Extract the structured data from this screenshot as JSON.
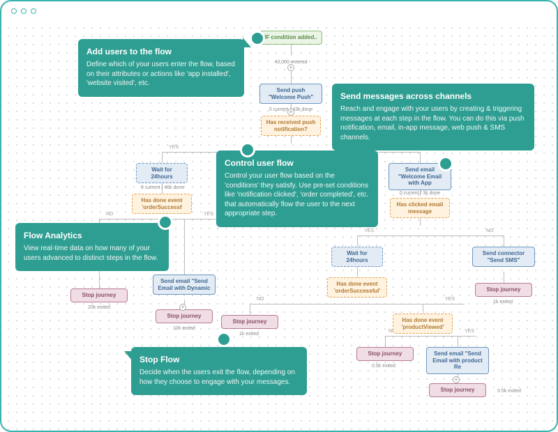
{
  "labels": {
    "yes": "YES",
    "no": "NO"
  },
  "nodes": {
    "ifCondition": "IF condition added..",
    "entered": "43,000 entered",
    "sendPush": "Send push \"Welcome Push\"",
    "pushStats": "0 current / 43k done",
    "hasReceivedPush": "Has received push notification?",
    "wait24": "Wait for 24hours",
    "waitStatsLeft": "0 current / 40k done",
    "orderSuccessShort": "Has done event 'orderSuccessf",
    "orderSuccessFull": "Has done event 'orderSuccessful'",
    "sendEmailDynamic": "Send email \"Send Email with Dynamic",
    "sendEmailWelcome": "Send email \"Welcome Email with App",
    "emailStats": "0 current / 3k done",
    "hasClickedEmail": "Has clicked email message",
    "sendSms": "Send connector \"Send SMS\"",
    "productViewed": "Has done event 'productViewed'",
    "sendEmailProduct": "Send email \"Send Email with product Re",
    "stop": "Stop journey",
    "exit20k": "20k exited",
    "exit10k": "10k exited",
    "exit1k": "1k exited",
    "exit05k": "0.5k exited"
  },
  "callouts": {
    "addUsers": {
      "title": "Add users to the flow",
      "body": "Define which of your users enter the flow, based on their attributes or actions like 'app installed', 'website visited', etc."
    },
    "sendMessages": {
      "title": "Send messages across channels",
      "body": "Reach and engage with your users by creating & triggering messages at each step in the flow. You can do this via push notification, email, in-app message, web push & SMS channels."
    },
    "controlFlow": {
      "title": "Control user flow",
      "body": "Control your user flow based on the 'conditions' they satisfy. Use pre-set conditions like 'notification clicked', 'order completed', etc. that automatically flow the user to the next appropriate step."
    },
    "analytics": {
      "title": "Flow Analytics",
      "body": "View real-time data on how many of your users advanced to distinct steps in the flow."
    },
    "stopFlow": {
      "title": "Stop Flow",
      "body": "Decide when the users exit the flow, depending on how they choose to engage with your messages."
    }
  }
}
